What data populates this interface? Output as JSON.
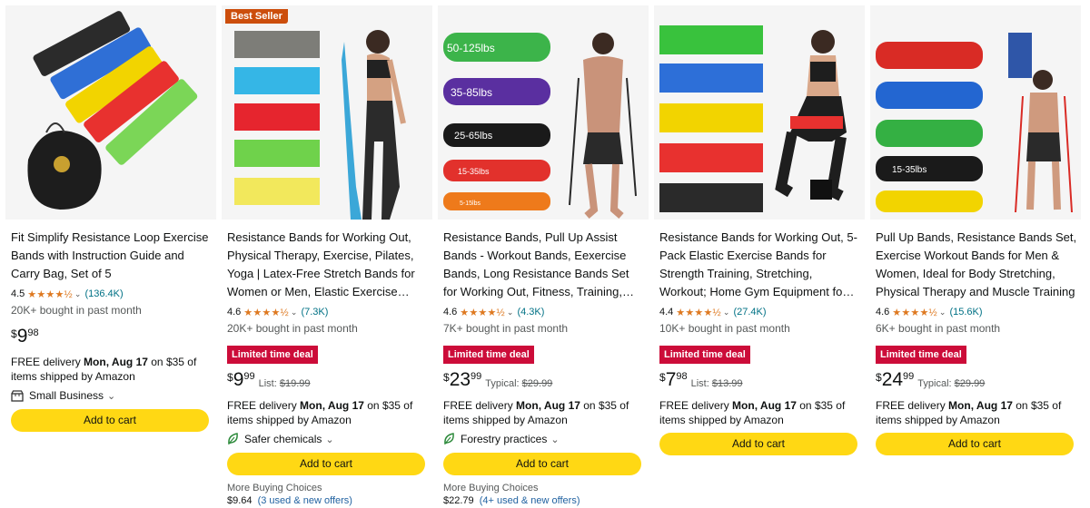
{
  "accent": {
    "cart_button": "#ffd814",
    "deal_badge": "#cc0c39",
    "best_seller": "#cc4e0c",
    "stars": "#de7921",
    "link": "#007185"
  },
  "products": [
    {
      "title": "Fit Simplify Resistance Loop Exercise Bands with Instruction Guide and Carry Bag, Set of 5",
      "rating": "4.5",
      "review_count": "(136.4K)",
      "bought": "20K+ bought in past month",
      "price_currency": "$",
      "price_whole": "9",
      "price_fraction": "98",
      "delivery_prefix": "FREE delivery ",
      "delivery_date": "Mon, Aug 17",
      "delivery_suffix": " on $35 of items shipped by Amazon",
      "feature_label": "Small Business",
      "feature_icon": "store-icon",
      "cart_label": "Add to cart"
    },
    {
      "badge": "Best Seller",
      "title": "Resistance Bands for Working Out, Physical Therapy, Exercise, Pilates, Yoga | Latex-Free Stretch Bands for Women or Men, Elastic Exercise…",
      "rating": "4.6",
      "review_count": "(7.3K)",
      "bought": "20K+ bought in past month",
      "deal": "Limited time deal",
      "price_currency": "$",
      "price_whole": "9",
      "price_fraction": "99",
      "list_label": "List:",
      "list_price": "$19.99",
      "delivery_prefix": "FREE delivery ",
      "delivery_date": "Mon, Aug 17",
      "delivery_suffix": " on $35 of items shipped by Amazon",
      "feature_label": "Safer chemicals",
      "feature_icon": "leaf-icon",
      "cart_label": "Add to cart",
      "more_choices": "More Buying Choices",
      "more_price": "$9.64",
      "more_offers": "(3 used & new offers)"
    },
    {
      "title": "Resistance Bands, Pull Up Assist Bands - Workout Bands, Eexercise Bands, Long Resistance Bands Set for Working Out, Fitness, Training,…",
      "rating": "4.6",
      "review_count": "(4.3K)",
      "bought": "7K+ bought in past month",
      "deal": "Limited time deal",
      "price_currency": "$",
      "price_whole": "23",
      "price_fraction": "99",
      "list_label": "Typical:",
      "list_price": "$29.99",
      "delivery_prefix": "FREE delivery ",
      "delivery_date": "Mon, Aug 17",
      "delivery_suffix": " on $35 of items shipped by Amazon",
      "feature_label": "Forestry practices",
      "feature_icon": "leaf-icon",
      "cart_label": "Add to cart",
      "more_choices": "More Buying Choices",
      "more_price": "$22.79",
      "more_offers": "(4+ used & new offers)",
      "band_labels": [
        "50-125lbs",
        "35-85lbs",
        "25-65lbs",
        "15-35lbs",
        "5-15lbs"
      ]
    },
    {
      "title": "Resistance Bands for Working Out, 5-Pack Elastic Exercise Bands for Strength Training, Stretching, Workout; Home Gym Equipment fo…",
      "rating": "4.4",
      "review_count": "(27.4K)",
      "bought": "10K+ bought in past month",
      "deal": "Limited time deal",
      "price_currency": "$",
      "price_whole": "7",
      "price_fraction": "98",
      "list_label": "List:",
      "list_price": "$13.99",
      "delivery_prefix": "FREE delivery ",
      "delivery_date": "Mon, Aug 17",
      "delivery_suffix": " on $35 of items shipped by Amazon",
      "cart_label": "Add to cart"
    },
    {
      "title": "Pull Up Bands, Resistance Bands Set, Exercise Workout Bands for Men & Women, Ideal for Body Stretching, Physical Therapy and Muscle Training",
      "rating": "4.6",
      "review_count": "(15.6K)",
      "bought": "6K+ bought in past month",
      "deal": "Limited time deal",
      "price_currency": "$",
      "price_whole": "24",
      "price_fraction": "99",
      "list_label": "Typical:",
      "list_price": "$29.99",
      "delivery_prefix": "FREE delivery ",
      "delivery_date": "Mon, Aug 17",
      "delivery_suffix": " on $35 of items shipped by Amazon",
      "cart_label": "Add to cart",
      "band_labels": [
        "15-35lbs"
      ]
    }
  ]
}
